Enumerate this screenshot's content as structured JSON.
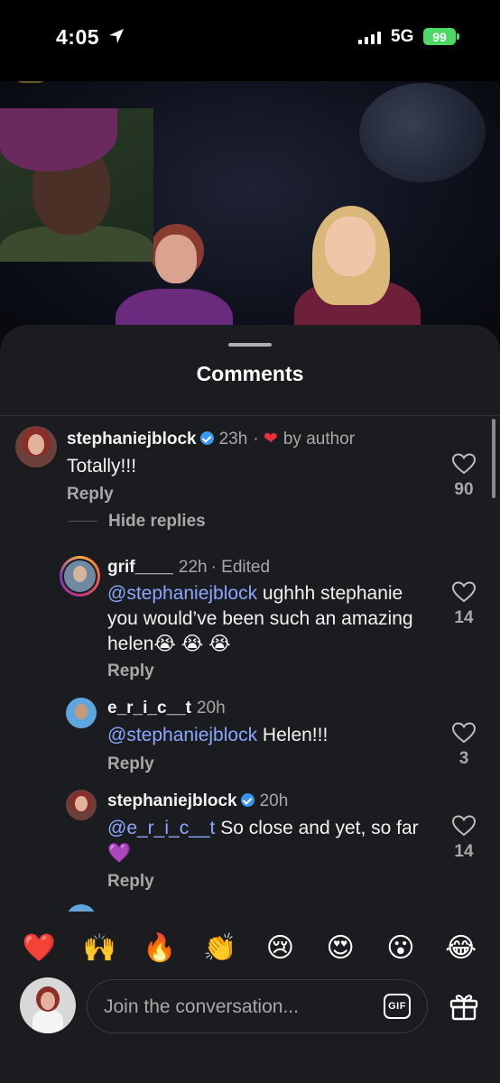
{
  "status_bar": {
    "time": "4:05",
    "network": "5G",
    "battery": "99"
  },
  "sheet": {
    "title": "Comments"
  },
  "comments": [
    {
      "username": "stephaniejblock",
      "verified": true,
      "age": "23h",
      "badge": "by author",
      "text": "Totally!!!",
      "reply_label": "Reply",
      "likes": "90",
      "hide_replies_label": "Hide replies"
    }
  ],
  "replies": [
    {
      "username": "grif____",
      "age": "22h",
      "edited": "· Edited",
      "mention": "@stephaniejblock",
      "text": " ughhh stephanie you would’ve been such an amazing helen😭 😭 😭",
      "reply_label": "Reply",
      "likes": "14"
    },
    {
      "username": "e_r_i_c__t",
      "age": "20h",
      "mention": "@stephaniejblock",
      "text": " Helen!!!",
      "reply_label": "Reply",
      "likes": "3"
    },
    {
      "username": "stephaniejblock",
      "verified": true,
      "age": "20h",
      "mention": "@e_r_i_c__t",
      "text": "  So close and yet, so far 💜",
      "reply_label": "Reply",
      "likes": "14"
    }
  ],
  "emoji_bar": [
    "❤️",
    "🙌",
    "🔥",
    "👏",
    "😢",
    "😍",
    "😮",
    "😂"
  ],
  "input": {
    "placeholder": "Join the conversation...",
    "gif_label": "GIF"
  }
}
